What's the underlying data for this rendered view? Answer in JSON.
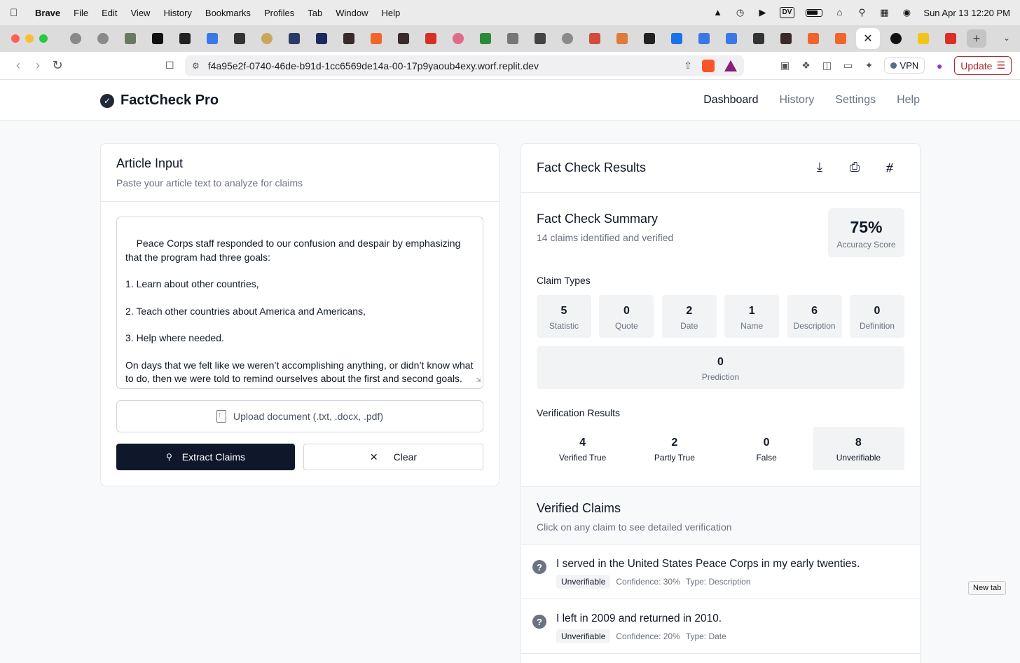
{
  "menubar": {
    "app": "Brave",
    "items": [
      "File",
      "Edit",
      "View",
      "History",
      "Bookmarks",
      "Profiles",
      "Tab",
      "Window",
      "Help"
    ],
    "dv": "DV",
    "datetime": "Sun Apr 13  12:20 PM"
  },
  "browser": {
    "url": "f4a95e2f-0740-46de-b91d-1cc6569de14a-00-17p9yaoub4exy.worf.replit.dev",
    "vpn": "VPN",
    "update": "Update",
    "tooltip": "New tab",
    "tab_icons": [
      "globe",
      "globe",
      "image",
      "square-r",
      "dot-c",
      "doc",
      "pin",
      "ring",
      "wave",
      "br",
      "dark",
      "orange",
      "dark",
      "gmail",
      "heart",
      "x",
      "tools",
      "people",
      "globe",
      "shield",
      "burst",
      "m",
      "compass",
      "doc",
      "doc",
      "pin",
      "dark",
      "orange",
      "orange",
      "close",
      "circle",
      "yellow",
      "gmail"
    ]
  },
  "app": {
    "brand": "FactCheck Pro",
    "nav": [
      "Dashboard",
      "History",
      "Settings",
      "Help"
    ]
  },
  "input": {
    "title": "Article Input",
    "subtitle": "Paste your article text to analyze for claims",
    "article": "Peace Corps staff responded to our confusion and despair by emphasizing that the program had three goals:\n\n1. Learn about other countries,\n\n2. Teach other countries about America and Americans,\n\n3. Help where needed.\n\nOn days that we felt like we weren’t accomplishing anything, or didn’t know what to do, then we were told to remind ourselves about the first and second goals.",
    "upload": "Upload document (.txt, .docx, .pdf)",
    "extract": "Extract Claims",
    "clear": "Clear"
  },
  "results": {
    "title": "Fact Check Results",
    "summary_title": "Fact Check Summary",
    "summary_sub": "14 claims identified and verified",
    "accuracy": "75%",
    "accuracy_label": "Accuracy Score",
    "claim_types_label": "Claim Types",
    "claim_types": [
      {
        "n": "5",
        "label": "Statistic"
      },
      {
        "n": "0",
        "label": "Quote"
      },
      {
        "n": "2",
        "label": "Date"
      },
      {
        "n": "1",
        "label": "Name"
      },
      {
        "n": "6",
        "label": "Description"
      },
      {
        "n": "0",
        "label": "Definition"
      },
      {
        "n": "0",
        "label": "Prediction"
      }
    ],
    "verification_label": "Verification Results",
    "verification": [
      {
        "n": "4",
        "label": "Verified True"
      },
      {
        "n": "2",
        "label": "Partly True"
      },
      {
        "n": "0",
        "label": "False"
      },
      {
        "n": "8",
        "label": "Unverifiable"
      }
    ],
    "claims_title": "Verified Claims",
    "claims_sub": "Click on any claim to see detailed verification",
    "claims": [
      {
        "text": "I served in the United States Peace Corps in my early twenties.",
        "status": "Unverifiable",
        "confidence": "Confidence: 30%",
        "type": "Type: Description"
      },
      {
        "text": "I left in 2009 and returned in 2010.",
        "status": "Unverifiable",
        "confidence": "Confidence: 20%",
        "type": "Type: Date"
      }
    ]
  }
}
